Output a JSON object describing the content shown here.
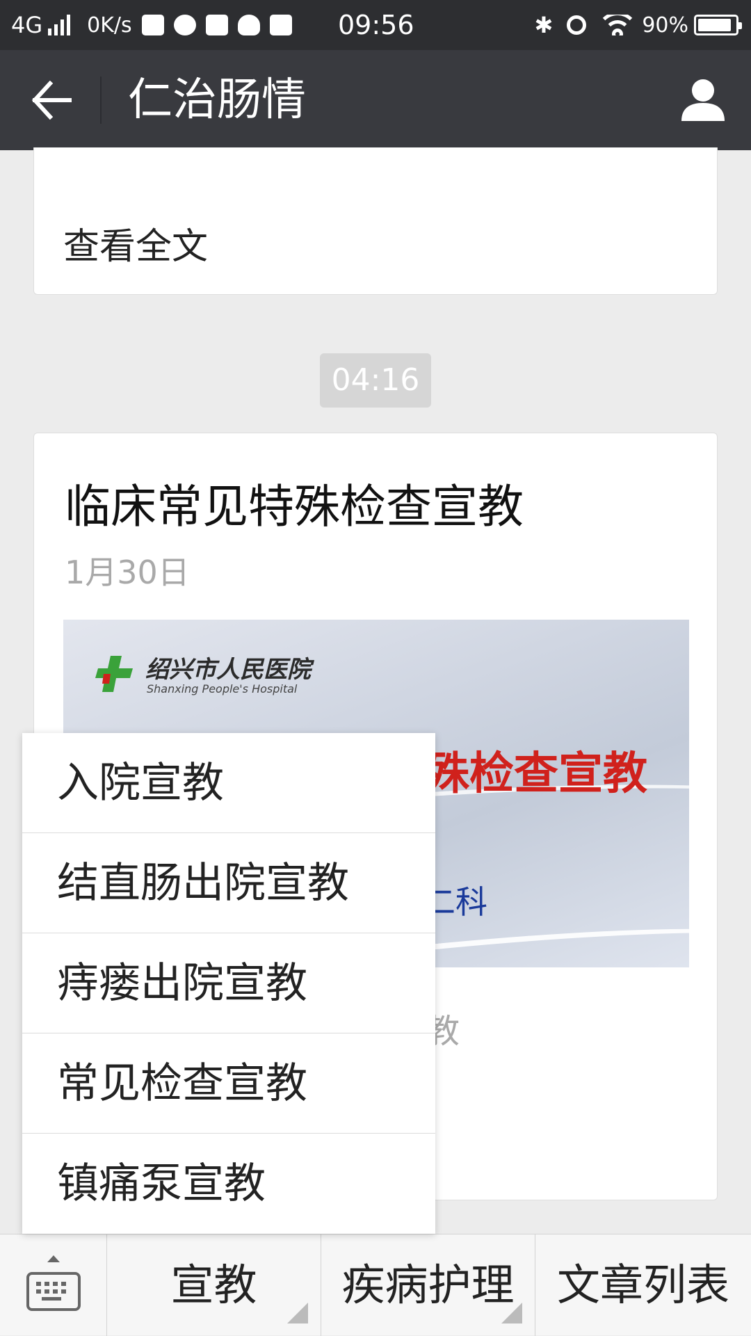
{
  "status_bar": {
    "network": "4G",
    "speed": "0K/s",
    "time": "09:56",
    "battery": "90%",
    "battery_level": 0.9
  },
  "header": {
    "title": "仁治肠情"
  },
  "prev_card": {
    "read_all": "查看全文"
  },
  "time_badge": "04:16",
  "article": {
    "title": "临床常见特殊检查宣教",
    "date": "1月30日",
    "cover": {
      "hospital_cn": "绍兴市人民医院",
      "hospital_en": "Shanxing People's Hospital",
      "title_visible": "殊检查宣教",
      "dept_visible": "二科"
    },
    "summary_visible": "教"
  },
  "menu": {
    "items": [
      {
        "label": "入院宣教"
      },
      {
        "label": "结直肠出院宣教"
      },
      {
        "label": "痔瘘出院宣教"
      },
      {
        "label": "常见检查宣教"
      },
      {
        "label": "镇痛泵宣教"
      }
    ]
  },
  "bottom_bar": {
    "tabs": [
      {
        "label": "宣教"
      },
      {
        "label": "疾病护理"
      },
      {
        "label": "文章列表"
      }
    ]
  },
  "colors": {
    "status_bar_bg": "#2d2e31",
    "header_bg": "#393a3f",
    "page_bg": "#ececec",
    "cover_title_red": "#d0211c",
    "cover_dept_blue": "#1a3a9a"
  },
  "icons": [
    "back-arrow-icon",
    "profile-icon",
    "keyboard-icon",
    "bluetooth-icon",
    "alarm-icon",
    "wifi-icon",
    "battery-icon",
    "signal-icon"
  ]
}
